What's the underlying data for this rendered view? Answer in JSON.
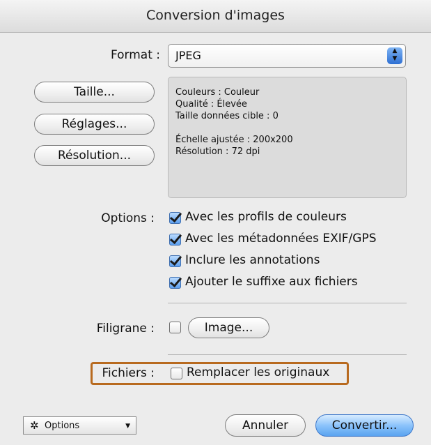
{
  "dialog": {
    "title": "Conversion d'images"
  },
  "format": {
    "label": "Format :",
    "selected": "JPEG",
    "stepper_up": "▲",
    "stepper_down": "▼"
  },
  "buttons": {
    "taille": "Taille...",
    "reglages": "Réglages...",
    "resolution": "Résolution...",
    "image": "Image...",
    "annuler": "Annuler",
    "convertir": "Convertir..."
  },
  "info": {
    "couleurs": "Couleurs : Couleur",
    "qualite": "Qualité : Élevée",
    "taille_cible": "Taille données cible : 0",
    "echelle": "Échelle ajustée : 200x200",
    "resolution": "Résolution : 72 dpi"
  },
  "options": {
    "label": "Options :",
    "items": [
      {
        "label": "Avec les profils de couleurs",
        "checked": true
      },
      {
        "label": "Avec les métadonnées EXIF/GPS",
        "checked": true
      },
      {
        "label": "Inclure les annotations",
        "checked": true
      },
      {
        "label": "Ajouter le suffixe aux fichiers",
        "checked": true
      }
    ]
  },
  "filigrane": {
    "label": "Filigrane :",
    "checked": false
  },
  "fichiers": {
    "label": "Fichiers :",
    "option": "Remplacer les originaux",
    "checked": false
  },
  "action_menu": {
    "label": "Options",
    "icon": "gear-icon"
  },
  "colors": {
    "highlight": "#b86a1f",
    "accent": "#5aa4f0"
  }
}
